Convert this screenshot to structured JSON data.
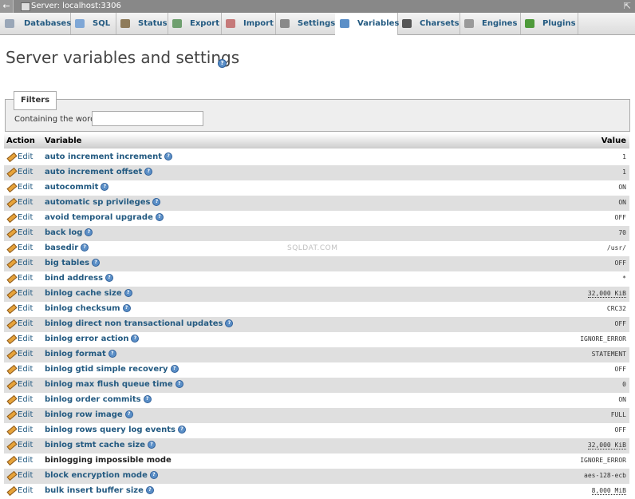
{
  "window": {
    "title": "Server: localhost:3306",
    "back": "←",
    "collapse": "⇱"
  },
  "tabs": [
    {
      "label": "Databases",
      "icon": "database-icon",
      "color": "#9aa7b8"
    },
    {
      "label": "SQL",
      "icon": "sql-icon",
      "color": "#7fa7d6"
    },
    {
      "label": "Status",
      "icon": "status-icon",
      "color": "#8e7b5a"
    },
    {
      "label": "Export",
      "icon": "export-icon",
      "color": "#6f9f6f"
    },
    {
      "label": "Import",
      "icon": "import-icon",
      "color": "#c67a7a"
    },
    {
      "label": "Settings",
      "icon": "wrench-icon",
      "color": "#8a8a8a"
    },
    {
      "label": "Variables",
      "icon": "variables-icon",
      "color": "#5b8fc7"
    },
    {
      "label": "Charsets",
      "icon": "charsets-icon",
      "color": "#555555"
    },
    {
      "label": "Engines",
      "icon": "engines-icon",
      "color": "#9a9a9a"
    },
    {
      "label": "Plugins",
      "icon": "plugin-icon",
      "color": "#4e9a3a"
    }
  ],
  "active_tab": "Variables",
  "page": {
    "title": "Server variables and settings"
  },
  "filters": {
    "legend": "Filters",
    "label": "Containing the word:",
    "value": ""
  },
  "table": {
    "headers": {
      "action": "Action",
      "variable": "Variable",
      "value": "Value"
    },
    "edit_label": "Edit",
    "rows": [
      {
        "name": "auto increment increment",
        "value": "1",
        "help": true
      },
      {
        "name": "auto increment offset",
        "value": "1",
        "help": true
      },
      {
        "name": "autocommit",
        "value": "ON",
        "help": true
      },
      {
        "name": "automatic sp privileges",
        "value": "ON",
        "help": true
      },
      {
        "name": "avoid temporal upgrade",
        "value": "OFF",
        "help": true
      },
      {
        "name": "back log",
        "value": "70",
        "help": true
      },
      {
        "name": "basedir",
        "value": "/usr/",
        "help": true
      },
      {
        "name": "big tables",
        "value": "OFF",
        "help": true
      },
      {
        "name": "bind address",
        "value": "*",
        "help": true
      },
      {
        "name": "binlog cache size",
        "value": "32,000 KiB",
        "help": true,
        "dotted": true
      },
      {
        "name": "binlog checksum",
        "value": "CRC32",
        "help": true
      },
      {
        "name": "binlog direct non transactional updates",
        "value": "OFF",
        "help": true
      },
      {
        "name": "binlog error action",
        "value": "IGNORE_ERROR",
        "help": true
      },
      {
        "name": "binlog format",
        "value": "STATEMENT",
        "help": true
      },
      {
        "name": "binlog gtid simple recovery",
        "value": "OFF",
        "help": true
      },
      {
        "name": "binlog max flush queue time",
        "value": "0",
        "help": true
      },
      {
        "name": "binlog order commits",
        "value": "ON",
        "help": true
      },
      {
        "name": "binlog row image",
        "value": "FULL",
        "help": true
      },
      {
        "name": "binlog rows query log events",
        "value": "OFF",
        "help": true
      },
      {
        "name": "binlog stmt cache size",
        "value": "32,000 KiB",
        "help": true,
        "dotted": true
      },
      {
        "name": "binlogging impossible mode",
        "value": "IGNORE_ERROR",
        "help": false,
        "plain": true
      },
      {
        "name": "block encryption mode",
        "value": "aes-128-ecb",
        "help": true
      },
      {
        "name": "bulk insert buffer size",
        "value": "8,000 MiB",
        "help": true,
        "dotted": true
      }
    ]
  },
  "watermark": "SQLDAT.COM"
}
